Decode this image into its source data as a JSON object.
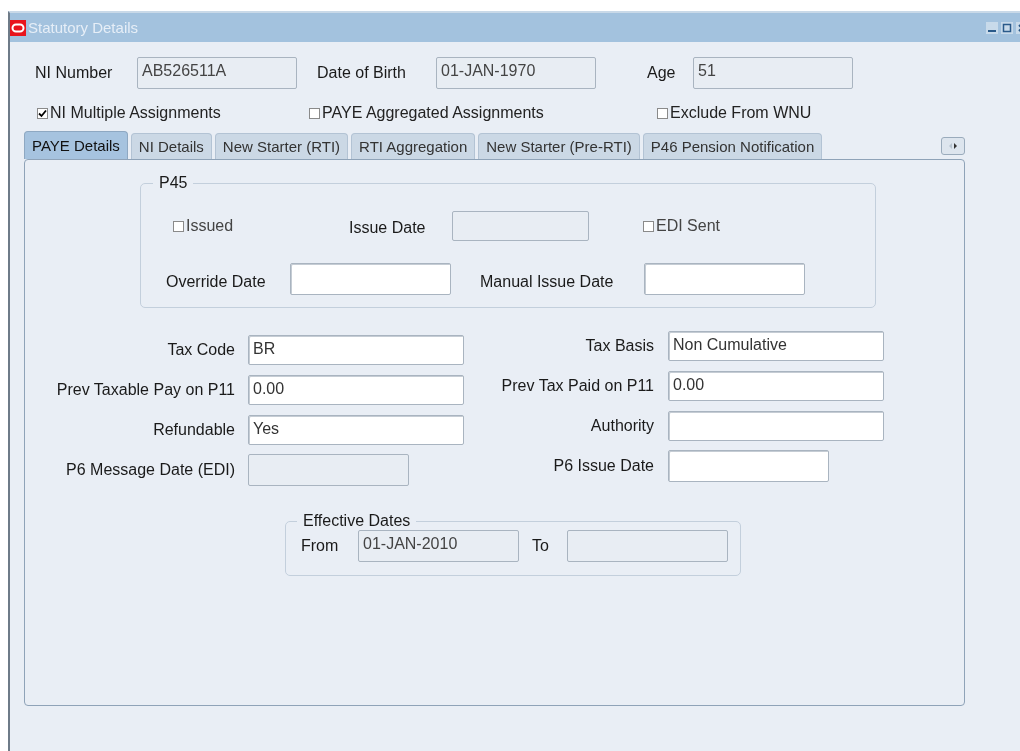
{
  "window": {
    "title": "Statutory Details"
  },
  "header_fields": [
    {
      "label": "NI Number",
      "value": "AB526511A",
      "disabled": true
    },
    {
      "label": "Date of Birth",
      "value": "01-JAN-1970",
      "disabled": true
    },
    {
      "label": "Age",
      "value": "51",
      "disabled": true
    }
  ],
  "options": [
    {
      "label": "NI Multiple Assignments",
      "checked": true
    },
    {
      "label": "PAYE Aggregated Assignments",
      "checked": false
    },
    {
      "label": "Exclude From WNU",
      "checked": false
    }
  ],
  "tabs": [
    {
      "label": "PAYE Details",
      "selected": true
    },
    {
      "label": "NI Details",
      "selected": false
    },
    {
      "label": "New Starter (RTI)",
      "selected": false
    },
    {
      "label": "RTI Aggregation",
      "selected": false
    },
    {
      "label": "New Starter (Pre-RTI)",
      "selected": false
    },
    {
      "label": "P46 Pension Notification",
      "selected": false
    }
  ],
  "p45": {
    "title": "P45",
    "issued": {
      "label": "Issued",
      "checked": false
    },
    "issue_date": {
      "label": "Issue Date",
      "disabled": true
    },
    "edi_sent": {
      "label": "EDI Sent",
      "checked": false
    },
    "override_date": {
      "label": "Override Date",
      "disabled": false
    },
    "manual_issue_date": {
      "label": "Manual Issue Date",
      "disabled": false
    }
  },
  "tax_left": [
    {
      "label": "Tax Code",
      "value": "BR",
      "disabled": false
    },
    {
      "label": "Prev Taxable Pay on P11",
      "value": "0.00",
      "disabled": false
    },
    {
      "label": "Refundable",
      "value": "Yes",
      "disabled": false
    },
    {
      "label": "P6 Message Date (EDI)",
      "disabled": true
    }
  ],
  "tax_right": [
    {
      "label": "Tax Basis",
      "value": "Non Cumulative",
      "disabled": false
    },
    {
      "label": "Prev Tax Paid on P11",
      "value": "0.00",
      "disabled": false
    },
    {
      "label": "Authority",
      "disabled": false
    },
    {
      "label": "P6 Issue Date",
      "disabled": false
    }
  ],
  "effective_dates": {
    "title": "Effective Dates",
    "from": {
      "label": "From",
      "value": "01-JAN-2010",
      "disabled": true
    },
    "to": {
      "label": "To",
      "disabled": true
    }
  }
}
